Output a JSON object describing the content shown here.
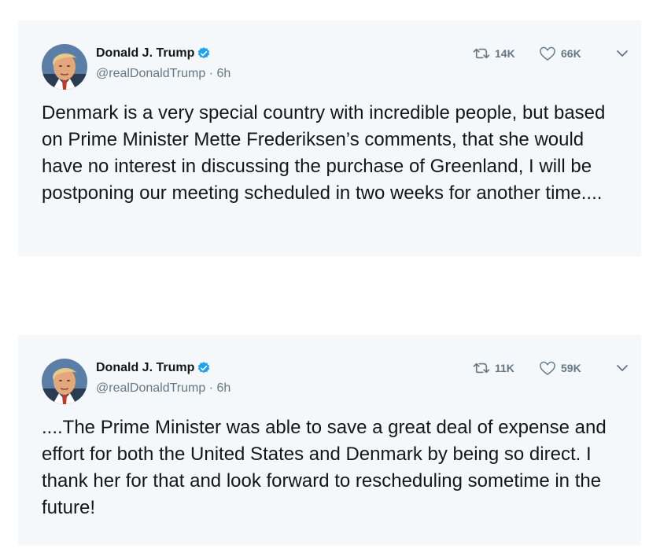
{
  "tweets": [
    {
      "author": {
        "display_name": "Donald J. Trump",
        "handle": "@realDonaldTrump",
        "verified": true
      },
      "time": "6h",
      "separator": "·",
      "retweets": "14K",
      "likes": "66K",
      "text": "Denmark is a very special country with incredible people, but based on Prime Minister Mette Frederiksen’s comments, that she would have no interest in discussing the purchase of Greenland, I will be postponing our meeting scheduled in two weeks for another time...."
    },
    {
      "author": {
        "display_name": "Donald J. Trump",
        "handle": "@realDonaldTrump",
        "verified": true
      },
      "time": "6h",
      "separator": "·",
      "retweets": "11K",
      "likes": "59K",
      "text": "....The Prime Minister was able to save a great deal of expense and effort for both the United States and Denmark by being so direct. I thank her for that and look forward to rescheduling sometime in the future!"
    }
  ],
  "colors": {
    "card_background": "#f5f8fa",
    "verified_blue": "#1da1f2",
    "secondary_text": "#657786",
    "primary_text": "#14171a"
  },
  "icons": {
    "retweet": "retweet-icon",
    "like": "heart-icon",
    "menu": "chevron-down-icon",
    "verified": "verified-badge-icon"
  }
}
